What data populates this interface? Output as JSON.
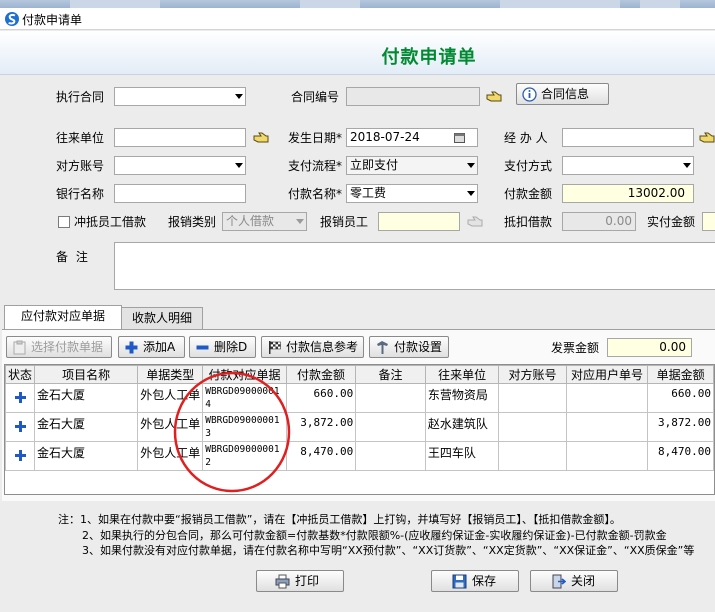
{
  "window": {
    "title": "付款申请单"
  },
  "form_title": "付款申请单",
  "fields": {
    "contract_label": "执行合同",
    "contract_value": "",
    "contract_no_label": "合同编号",
    "contract_no_value": "",
    "contract_info_button": "合同信息",
    "counterparty_label": "往来单位",
    "counterparty_value": "",
    "date_label": "发生日期*",
    "date_value": "2018-07-24",
    "handler_label": "经 办 人",
    "handler_value": "",
    "account_label": "对方账号",
    "account_value": "",
    "flow_label": "支付流程*",
    "flow_value": "立即支付",
    "pay_method_label": "支付方式",
    "pay_method_value": "",
    "bank_label": "银行名称",
    "bank_value": "",
    "pay_name_label": "付款名称*",
    "pay_name_value": "零工费",
    "amount_label": "付款金额",
    "amount_value": "13002.00",
    "offset_label": "冲抵员工借款",
    "claim_type_label": "报销类别",
    "claim_type_value": "个人借款",
    "claim_staff_label": "报销员工",
    "claim_staff_value": "",
    "deduct_label": "抵扣借款",
    "deduct_value": "0.00",
    "actual_label": "实付金额",
    "actual_value": "",
    "remark_label": "备  注",
    "remark_value": ""
  },
  "tabs": [
    {
      "label": "应付款对应单据",
      "active": true
    },
    {
      "label": "收款人明细",
      "active": false
    }
  ],
  "toolbar": {
    "select_button": "选择付款单据",
    "add_button": "添加A",
    "delete_button": "删除D",
    "ref_button": "付款信息参考",
    "settings_button": "付款设置",
    "invoice_label": "发票金额",
    "invoice_value": "0.00"
  },
  "grid": {
    "columns": [
      "状态",
      "项目名称",
      "单据类型",
      "付款对应单据",
      "付款金额",
      "备注",
      "往来单位",
      "对方账号",
      "对应用户单号",
      "单据金额"
    ],
    "rows": [
      {
        "project": "金石大厦",
        "doc_type": "外包人工单",
        "doc_no": "WBRGD090000014",
        "amount": "660.00",
        "remark": "",
        "counterparty": "东营物资局",
        "account": "",
        "user_no": "",
        "doc_amount": "660.00"
      },
      {
        "project": "金石大厦",
        "doc_type": "外包人工单",
        "doc_no": "WBRGD090000013",
        "amount": "3,872.00",
        "remark": "",
        "counterparty": "赵水建筑队",
        "account": "",
        "user_no": "",
        "doc_amount": "3,872.00"
      },
      {
        "project": "金石大厦",
        "doc_type": "外包人工单",
        "doc_no": "WBRGD090000012",
        "amount": "8,470.00",
        "remark": "",
        "counterparty": "王四车队",
        "account": "",
        "user_no": "",
        "doc_amount": "8,470.00"
      }
    ]
  },
  "notes": [
    "注：1、如果在付款中要“报销员工借款”，请在【冲抵员工借款】上打钩，并填写好【报销员工】、【抵扣借款金额】。",
    "2、如果执行的分包合同，那么可付款金额=付款基数*付款限额%-(应收履约保证金-实收履约保证金)-已付款金额-罚款金",
    "3、如果付款没有对应付款单据，请在付款名称中写明“XX预付款”、“XX订货款”、“XX定货款”、“XX保证金”、“XX质保金”等"
  ],
  "footer": {
    "print_button": "打印",
    "save_button": "保存",
    "close_button": "关闭"
  },
  "colors": {
    "title_green": "#008a32",
    "annotation_red": "#e02020",
    "plus_blue": "#1f59c7"
  }
}
